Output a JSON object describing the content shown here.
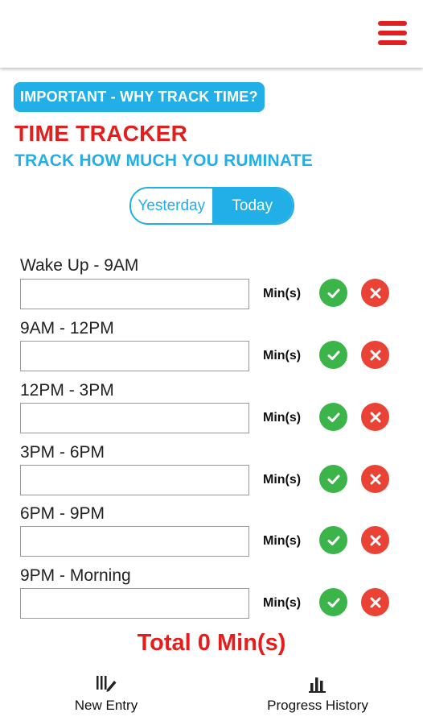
{
  "header": {
    "menu_icon": "hamburger-menu-icon",
    "menu_color": "#e02020"
  },
  "info_button": {
    "label": "IMPORTANT - WHY TRACK TIME?",
    "color": "#22aee6"
  },
  "page": {
    "title": "TIME TRACKER",
    "subtitle": "TRACK HOW MUCH YOU RUMINATE",
    "title_color": "#e41d1d",
    "subtitle_color": "#22aee6"
  },
  "day_toggle": {
    "options": [
      "Yesterday",
      "Today"
    ],
    "selected": "Today"
  },
  "slots": [
    {
      "label": "Wake Up - 9AM",
      "value": "",
      "unit": "Min(s)"
    },
    {
      "label": "9AM - 12PM",
      "value": "",
      "unit": "Min(s)"
    },
    {
      "label": "12PM - 3PM",
      "value": "",
      "unit": "Min(s)"
    },
    {
      "label": "3PM - 6PM",
      "value": "",
      "unit": "Min(s)"
    },
    {
      "label": "6PM - 9PM",
      "value": "",
      "unit": "Min(s)"
    },
    {
      "label": "9PM - Morning",
      "value": "",
      "unit": "Min(s)"
    }
  ],
  "slot_buttons": {
    "confirm_icon": "checkmark-icon",
    "confirm_color": "#3bb54a",
    "clear_icon": "close-icon",
    "clear_color": "#ea4335"
  },
  "total": {
    "text": "Total 0 Min(s)"
  },
  "bottom_nav": [
    {
      "label": "New Entry",
      "icon": "edit-list-icon"
    },
    {
      "label": "Progress History",
      "icon": "bar-chart-icon"
    }
  ]
}
